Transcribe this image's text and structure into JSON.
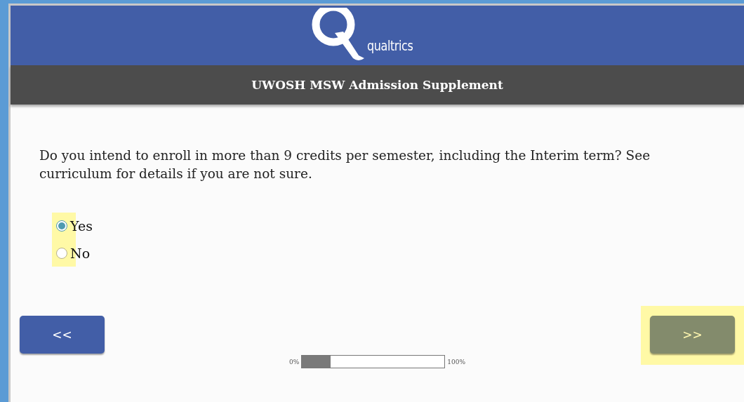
{
  "header": {
    "logo_text": "qualtrics"
  },
  "survey_title": "UWOSH MSW Admission Supplement",
  "question": {
    "text": "Do you intend to enroll in more than 9 credits per semester, including the Interim term? See curriculum for details if you are not sure.",
    "highlighted": true,
    "options": [
      {
        "label": "Yes",
        "selected": true
      },
      {
        "label": "No",
        "selected": false
      }
    ]
  },
  "buttons": [
    {
      "label": "<<",
      "kind": "back",
      "highlighted": false
    },
    {
      "label": ">>",
      "kind": "next",
      "highlighted": true
    }
  ],
  "progress": {
    "start_label": "0%",
    "end_label": "100%",
    "level": 0.2
  }
}
